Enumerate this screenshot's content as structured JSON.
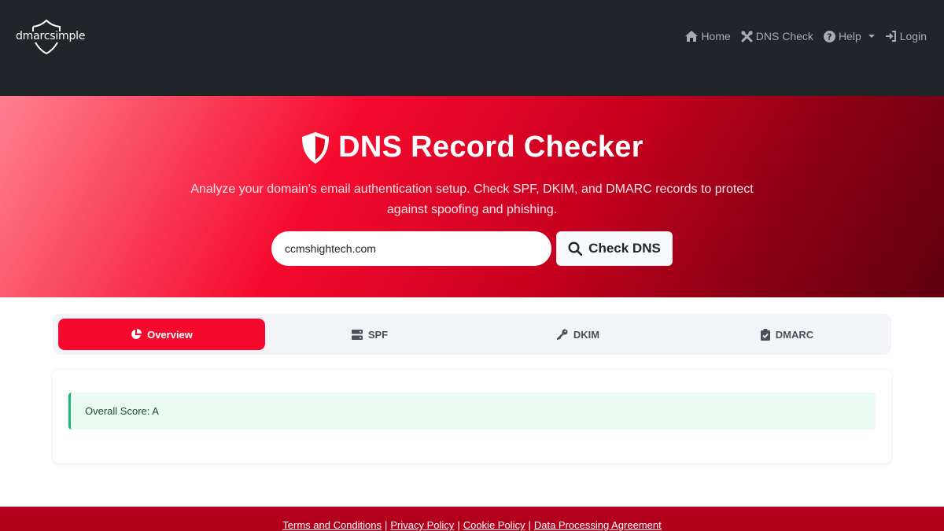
{
  "navbar": {
    "brand": "dmarcsimple",
    "items": [
      {
        "label": "Home",
        "icon": "home-icon"
      },
      {
        "label": "DNS Check",
        "icon": "tools-icon"
      },
      {
        "label": "Help",
        "icon": "question-circle-icon"
      },
      {
        "label": "Login",
        "icon": "sign-in-icon"
      }
    ]
  },
  "hero": {
    "title": "DNS Record Checker",
    "icon": "shield-icon",
    "subtitle": "Analyze your domain's email authentication setup. Check SPF, DKIM, and DMARC records to protect against spoofing and phishing.",
    "search": {
      "value": "ccmshightech.com",
      "placeholder": ""
    },
    "button_label": "Check DNS"
  },
  "tabs": [
    {
      "label": "Overview",
      "icon": "pie-chart-icon",
      "active": true
    },
    {
      "label": "SPF",
      "icon": "server-icon",
      "active": false
    },
    {
      "label": "DKIM",
      "icon": "key-icon",
      "active": false
    },
    {
      "label": "DMARC",
      "icon": "clipboard-check-icon",
      "active": false
    }
  ],
  "result": {
    "text": "Overall Score: A"
  },
  "footer": {
    "links": [
      "Terms and Conditions",
      "Privacy Policy",
      "Cookie Policy",
      "Data Processing Agreement"
    ],
    "separator": "|"
  },
  "colors": {
    "navbar_bg": "#212529",
    "accent": "#f50a2e",
    "footer_bg": "#b3001d",
    "success_border": "#1fb679",
    "success_bg": "#e9fbf2"
  }
}
